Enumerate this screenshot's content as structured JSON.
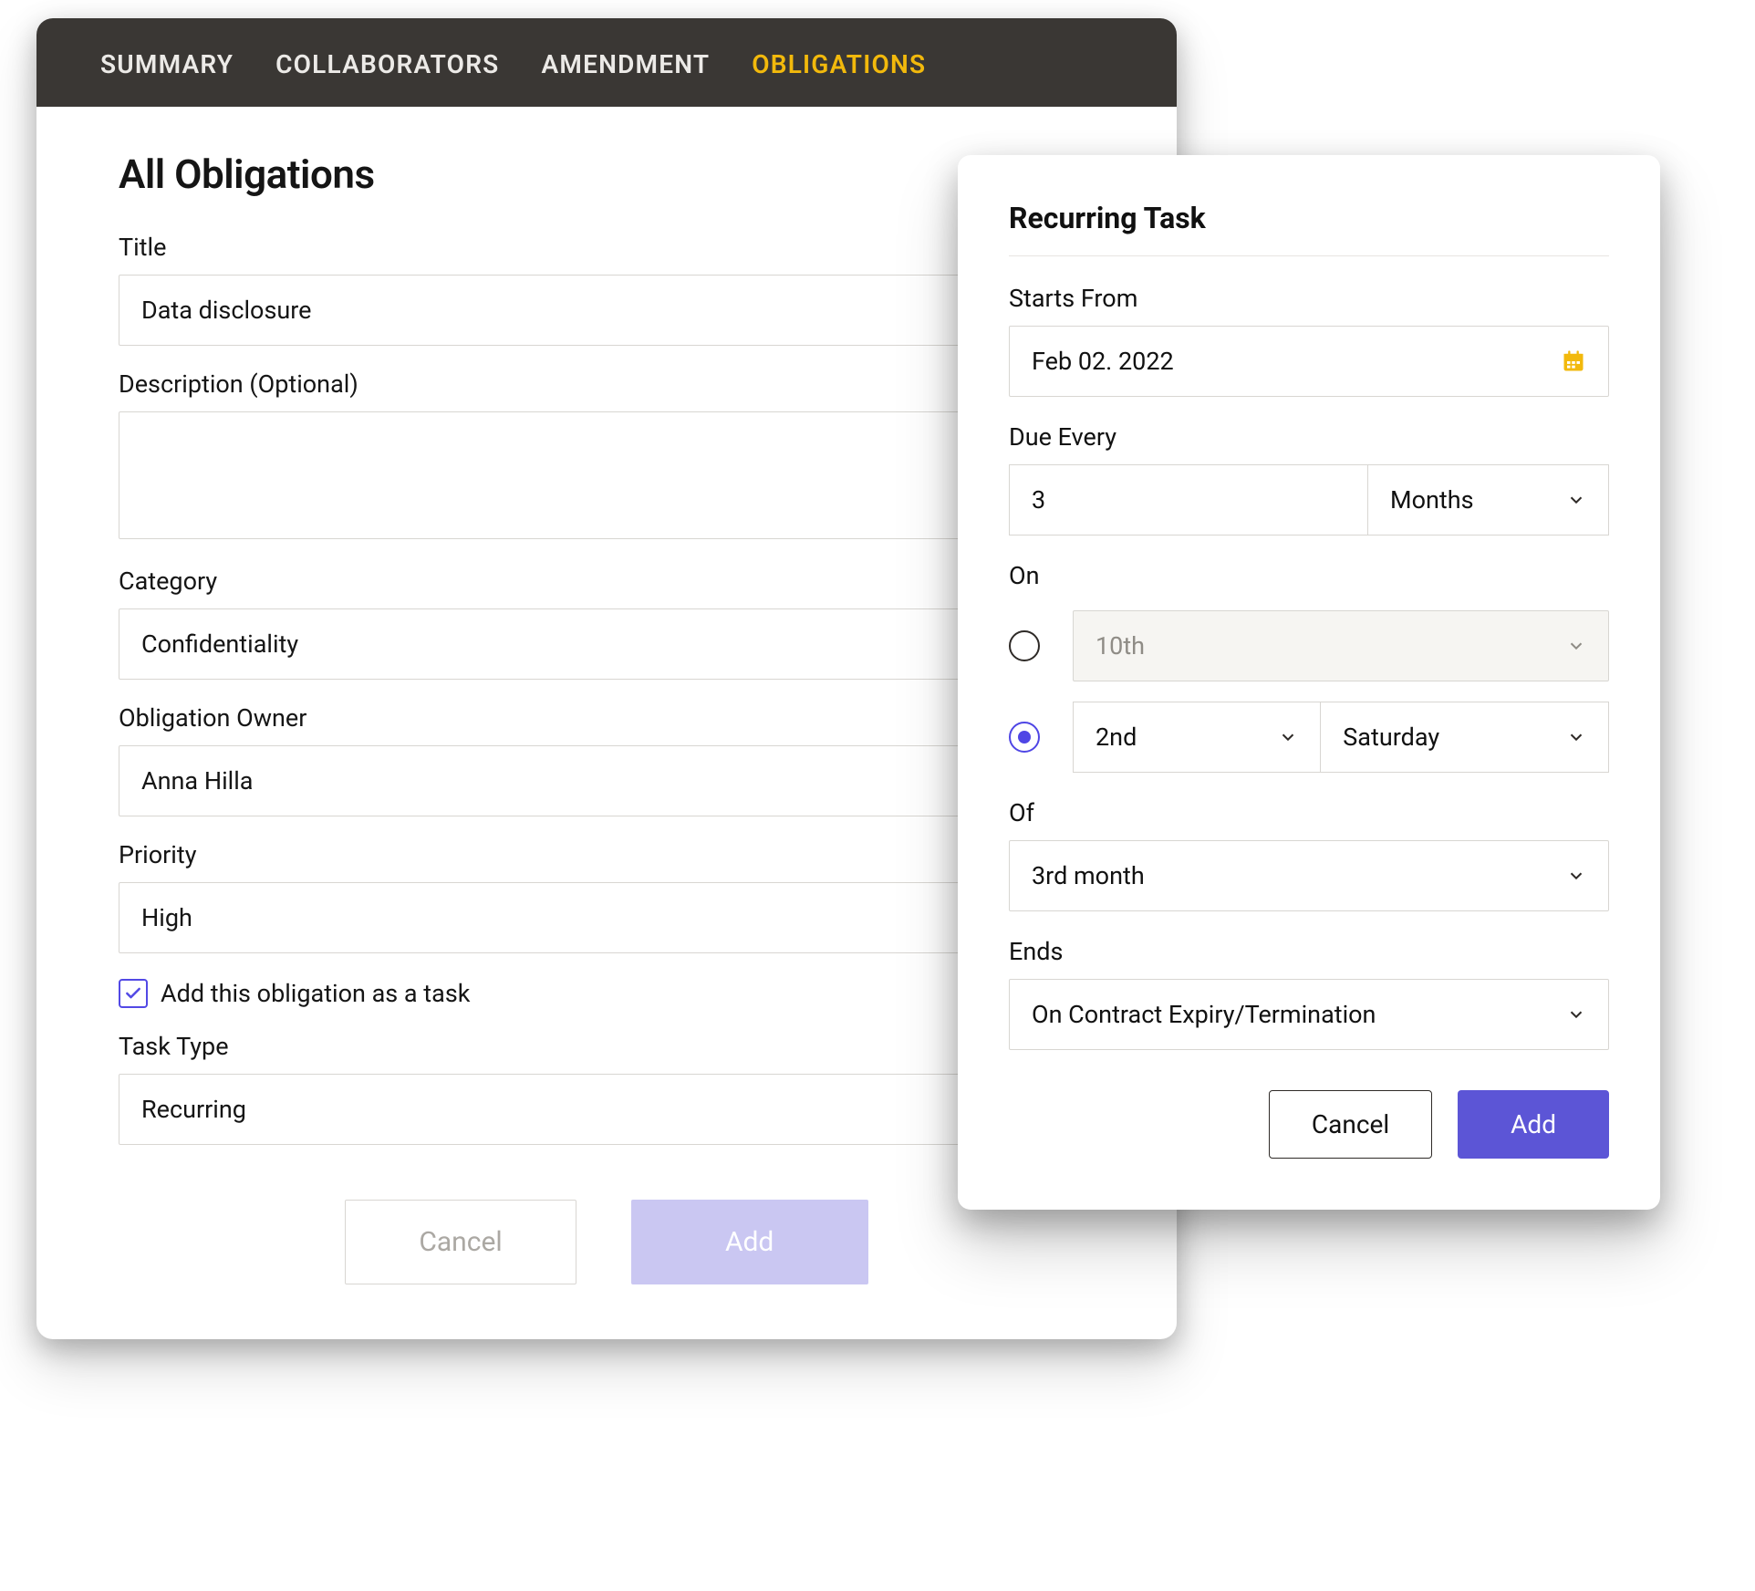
{
  "tabs": {
    "summary": "SUMMARY",
    "collaborators": "COLLABORATORS",
    "amendment": "AMENDMENT",
    "obligations": "OBLIGATIONS"
  },
  "page": {
    "title": "All Obligations",
    "labels": {
      "title": "Title",
      "description": "Description (Optional)",
      "category": "Category",
      "owner": "Obligation Owner",
      "priority": "Priority",
      "add_as_task": "Add this obligation as a task",
      "task_type": "Task Type"
    },
    "values": {
      "title": "Data disclosure",
      "description": "",
      "category": "Confidentiality",
      "owner": "Anna Hilla",
      "priority": "High",
      "task_type": "Recurring"
    },
    "actions": {
      "cancel": "Cancel",
      "add": "Add"
    }
  },
  "popup": {
    "title": "Recurring Task",
    "labels": {
      "starts_from": "Starts From",
      "due_every": "Due Every",
      "on": "On",
      "of": "Of",
      "ends": "Ends"
    },
    "values": {
      "starts_from": "Feb 02. 2022",
      "due_every_value": "3",
      "due_every_unit": "Months",
      "on_day": "10th",
      "on_ordinal": "2nd",
      "on_weekday": "Saturday",
      "of": "3rd month",
      "ends": "On Contract Expiry/Termination"
    },
    "actions": {
      "cancel": "Cancel",
      "add": "Add"
    }
  }
}
